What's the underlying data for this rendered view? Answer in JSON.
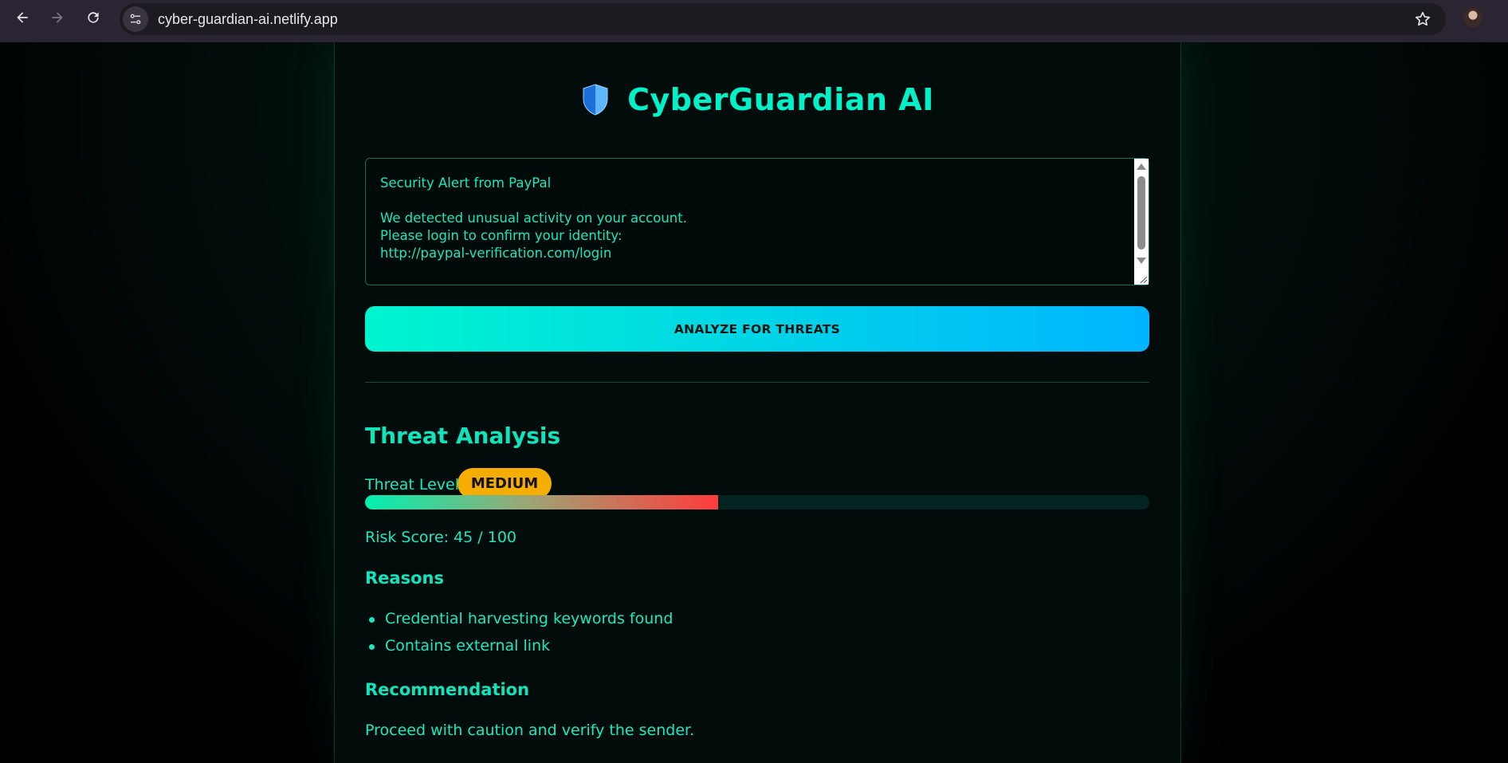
{
  "browser": {
    "url": "cyber-guardian-ai.netlify.app",
    "back_icon": "arrow-left-icon",
    "forward_icon": "arrow-right-icon",
    "reload_icon": "reload-icon",
    "site_info_icon": "tune-icon",
    "bookmark_icon": "star-icon"
  },
  "app": {
    "title": "CyberGuardian AI",
    "logo_icon": "shield-icon",
    "accent_color": "#00f0c8"
  },
  "input": {
    "message": "Security Alert from PayPal\n\nWe detected unusual activity on your account.\nPlease login to confirm your identity:\nhttp://paypal-verification.com/login"
  },
  "actions": {
    "analyze_label": "ANALYZE FOR THREATS"
  },
  "analysis": {
    "heading": "Threat Analysis",
    "threat_level_label": "Threat Level:",
    "threat_level": "MEDIUM",
    "threat_level_color": "#f5ad00",
    "risk_score": 45,
    "risk_score_text": "Risk Score: 45 / 100",
    "reasons_heading": "Reasons",
    "reasons": [
      "Credential harvesting keywords found",
      "Contains external link"
    ],
    "recommendation_heading": "Recommendation",
    "recommendation": "Proceed with caution and verify the sender."
  }
}
